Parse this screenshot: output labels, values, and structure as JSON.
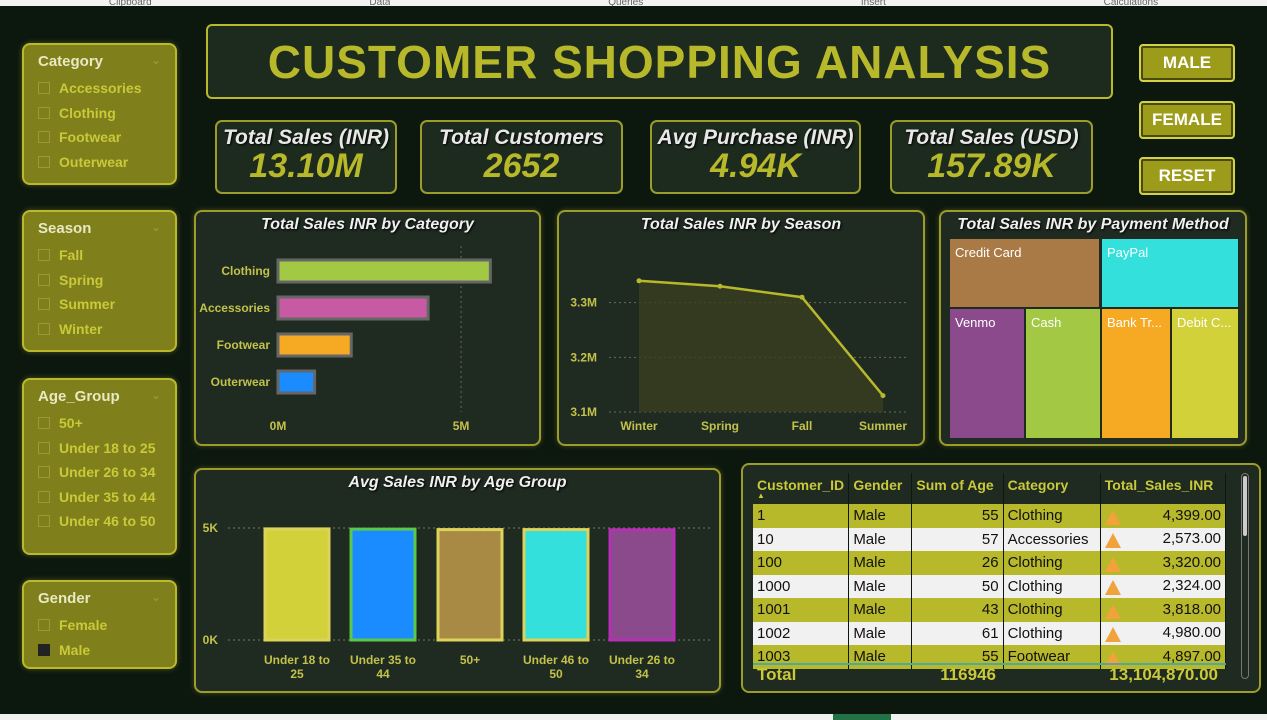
{
  "ribbon": [
    "Clipboard",
    "Data",
    "Queries",
    "Insert",
    "Calculations"
  ],
  "title": "CUSTOMER SHOPPING ANALYSIS",
  "gender_buttons": {
    "male": "MALE",
    "female": "FEMALE",
    "reset": "RESET"
  },
  "slicers": {
    "category": {
      "title": "Category",
      "items": [
        "Accessories",
        "Clothing",
        "Footwear",
        "Outerwear"
      ]
    },
    "season": {
      "title": "Season",
      "items": [
        "Fall",
        "Spring",
        "Summer",
        "Winter"
      ]
    },
    "age_group": {
      "title": "Age_Group",
      "items": [
        "50+",
        "Under 18 to 25",
        "Under 26 to 34",
        "Under 35 to 44",
        "Under 46 to 50"
      ]
    },
    "gender": {
      "title": "Gender",
      "items": [
        "Female",
        "Male"
      ],
      "selected": "Male"
    }
  },
  "kpis": [
    {
      "label": "Total Sales (INR)",
      "value": "13.10M"
    },
    {
      "label": "Total Customers",
      "value": "2652"
    },
    {
      "label": "Avg Purchase (INR)",
      "value": "4.94K"
    },
    {
      "label": "Total Sales (USD)",
      "value": "157.89K"
    }
  ],
  "chart_data": [
    {
      "type": "bar",
      "orientation": "horizontal",
      "title": "Total Sales INR by Category",
      "categories": [
        "Clothing",
        "Accessories",
        "Footwear",
        "Outerwear"
      ],
      "values": [
        5.8,
        4.1,
        2.0,
        1.0
      ],
      "colors": [
        "#a3c843",
        "#c75aa3",
        "#f6a923",
        "#1a8cff"
      ],
      "tick_labels": [
        "0M",
        "5M"
      ],
      "xlim": [
        0,
        6.5
      ]
    },
    {
      "type": "area",
      "title": "Total Sales INR by Season",
      "categories": [
        "Winter",
        "Spring",
        "Fall",
        "Summer"
      ],
      "values": [
        3.34,
        3.33,
        3.31,
        3.13
      ],
      "tick_labels": [
        "3.1M",
        "3.2M",
        "3.3M"
      ],
      "ylim": [
        3.1,
        3.4
      ]
    },
    {
      "type": "treemap",
      "title": "Total Sales INR by Payment Method",
      "labels": [
        "Credit Card",
        "PayPal",
        "Venmo",
        "Cash",
        "Bank Tr...",
        "Debit C..."
      ],
      "colors": [
        "#a97a46",
        "#33e0dc",
        "#8a4a8c",
        "#a3c843",
        "#f6a923",
        "#d3d13a"
      ]
    },
    {
      "type": "bar",
      "title": "Avg Sales INR by Age Group",
      "categories": [
        "Under 18 to 25",
        "Under 35 to 44",
        "50+",
        "Under 46 to 50",
        "Under 26 to 34"
      ],
      "category_lines": [
        [
          "Under 18 to",
          "25"
        ],
        [
          "Under 35 to",
          "44"
        ],
        [
          "50+"
        ],
        [
          "Under 46 to",
          "50"
        ],
        [
          "Under 26 to",
          "34"
        ]
      ],
      "values": [
        4.96,
        4.95,
        4.93,
        4.93,
        4.92
      ],
      "colors": [
        "#d3d13a",
        "#1a8cff",
        "#a98a45",
        "#33e0dc",
        "#8a4a8c"
      ],
      "tick_labels": [
        "0K",
        "5K"
      ],
      "ylim": [
        0,
        5
      ]
    }
  ],
  "table": {
    "headers": [
      "Customer_ID",
      "Gender",
      "Sum of Age",
      "Category",
      "Total_Sales_INR"
    ],
    "rows": [
      [
        "1",
        "Male",
        "55",
        "Clothing",
        "4,399.00"
      ],
      [
        "10",
        "Male",
        "57",
        "Accessories",
        "2,573.00"
      ],
      [
        "100",
        "Male",
        "26",
        "Clothing",
        "3,320.00"
      ],
      [
        "1000",
        "Male",
        "50",
        "Clothing",
        "2,324.00"
      ],
      [
        "1001",
        "Male",
        "43",
        "Clothing",
        "3,818.00"
      ],
      [
        "1002",
        "Male",
        "61",
        "Clothing",
        "4,980.00"
      ],
      [
        "1003",
        "Male",
        "55",
        "Footwear",
        "4,897.00"
      ]
    ],
    "total": {
      "label": "Total",
      "age": "116946",
      "sales": "13,104,870.00"
    }
  },
  "colors": {
    "accent": "#b8b82b",
    "slicer_bg": "#7f7f1c",
    "panel_bg": "#1f2a21"
  }
}
